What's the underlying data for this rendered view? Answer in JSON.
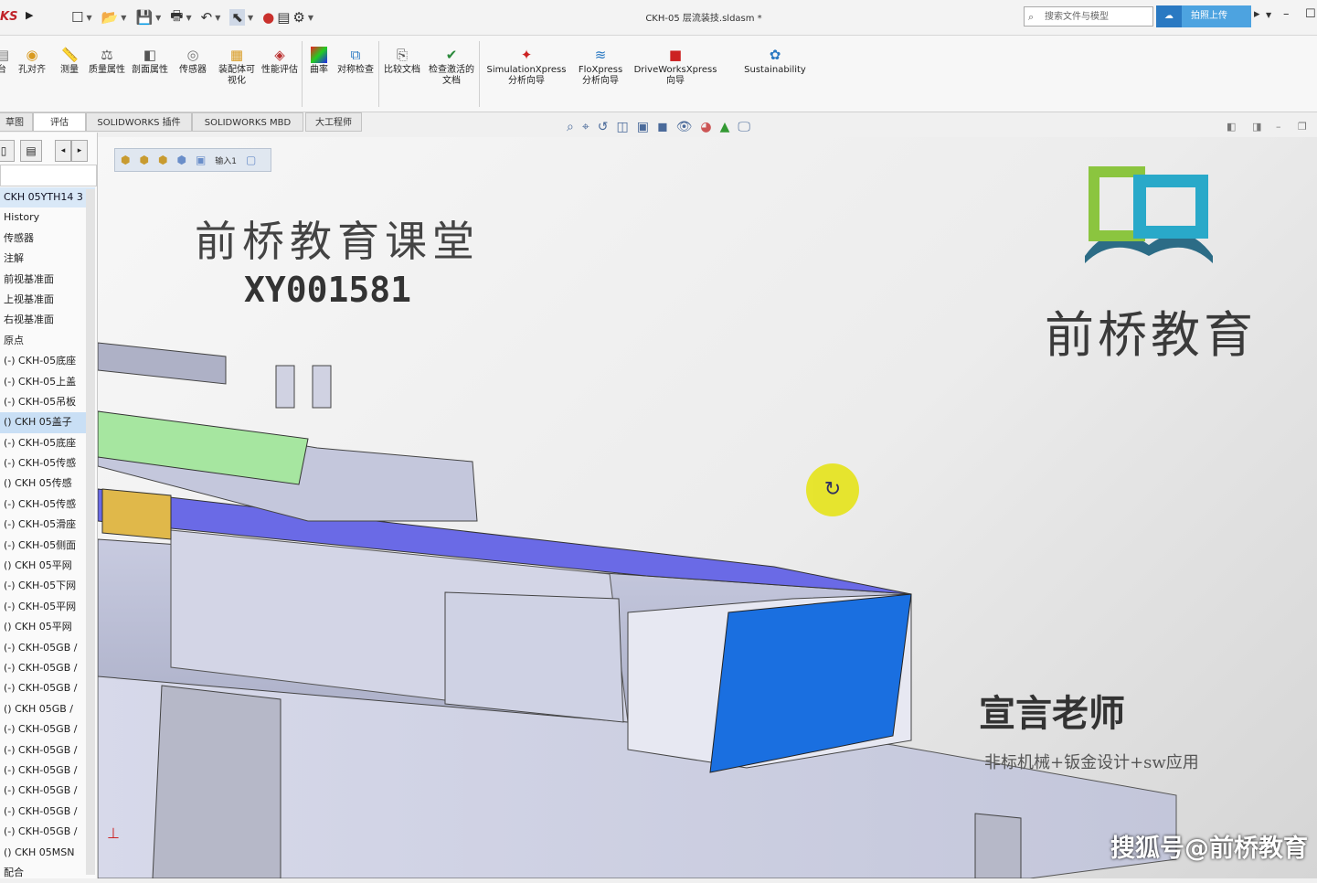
{
  "app": {
    "logo_text": "KS",
    "document_title": "CKH-05 层流装技.sldasm *",
    "search_placeholder": "搜索文件与模型",
    "upload_label": "拍照上传"
  },
  "ribbon": {
    "buttons": [
      {
        "label": "台",
        "icon": "tool-icon"
      },
      {
        "label": "孔对齐",
        "icon": "hole-align-icon"
      },
      {
        "label": "测量",
        "icon": "measure-icon"
      },
      {
        "label": "质量属性",
        "icon": "mass-props-icon"
      },
      {
        "label": "剖面属性",
        "icon": "section-props-icon"
      },
      {
        "label": "传感器",
        "icon": "sensor-icon"
      },
      {
        "label": "装配体可视化",
        "icon": "assembly-visual-icon"
      },
      {
        "label": "性能评估",
        "icon": "performance-icon"
      },
      {
        "label": "曲率",
        "icon": "curvature-icon"
      },
      {
        "label": "对称检查",
        "icon": "symmetry-icon"
      },
      {
        "label": "比较文档",
        "icon": "compare-icon"
      },
      {
        "label": "检查激活的文档",
        "icon": "check-doc-icon"
      },
      {
        "label": "SimulationXpress 分析向导",
        "icon": "simulation-icon"
      },
      {
        "label": "FloXpress 分析向导",
        "icon": "flow-icon"
      },
      {
        "label": "DriveWorksXpress 向导",
        "icon": "driveworks-icon"
      },
      {
        "label": "Sustainability",
        "icon": "sustainability-icon"
      }
    ]
  },
  "tabs": [
    {
      "label": "草图"
    },
    {
      "label": "评估"
    },
    {
      "label": "SOLIDWORKS 插件"
    },
    {
      "label": "SOLIDWORKS MBD"
    },
    {
      "label": "大工程师"
    }
  ],
  "breadcrumb": {
    "label": "输入1"
  },
  "feature_tree": {
    "root": "CKH 05YTH14 3",
    "items": [
      "History",
      "传感器",
      "注解",
      "前视基准面",
      "上视基准面",
      "右视基准面",
      "原点",
      "(-) CKH-05底座",
      "(-) CKH-05上盖",
      "(-) CKH-05吊板",
      "() CKH 05盖子",
      "(-) CKH-05底座",
      "(-) CKH-05传感",
      "() CKH 05传感",
      "(-) CKH-05传感",
      "(-) CKH-05滑座",
      "(-) CKH-05侧面",
      "() CKH 05平网",
      "(-) CKH-05下网",
      "(-) CKH-05平网",
      "() CKH 05平网",
      "(-) CKH-05GB /",
      "(-) CKH-05GB /",
      "(-) CKH-05GB /",
      "() CKH 05GB /",
      "(-) CKH-05GB /",
      "(-) CKH-05GB /",
      "(-) CKH-05GB /",
      "(-) CKH-05GB /",
      "(-) CKH-05GB /",
      "(-) CKH-05GB /",
      "() CKH 05MSN",
      "配合"
    ],
    "selected_index": 10
  },
  "watermarks": {
    "course": "前桥教育课堂",
    "code": "XY001581",
    "brand": "前桥教育",
    "teacher": "宣言老师",
    "tagline": "非标机械+钣金设计+sw应用",
    "sohu": "搜狐号@前桥教育"
  },
  "colors": {
    "accent": "#2a79c2",
    "upload_bg": "#4da3e0",
    "selection": "#c9dff5",
    "cursor_highlight": "#e6e41e",
    "model_blue": "#1a6fe0",
    "model_green": "#a6e6a0",
    "rail_purple": "#6a6ae6"
  }
}
